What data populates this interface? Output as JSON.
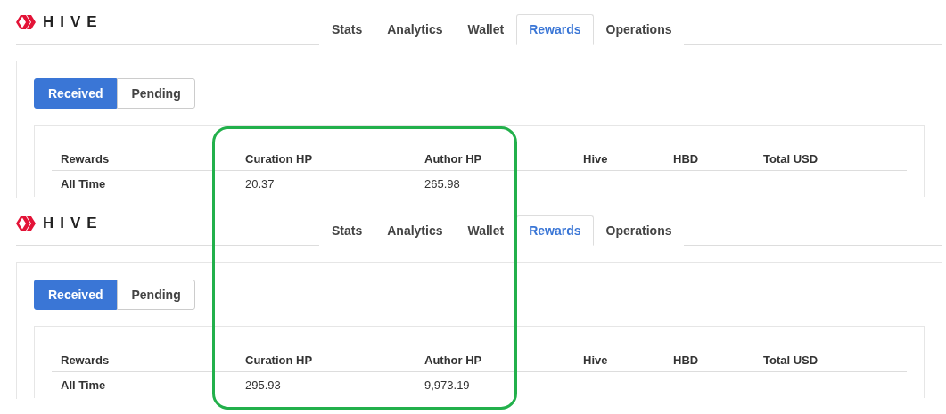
{
  "panels": [
    {
      "logo": "HIVE",
      "tabs": [
        {
          "label": "Stats",
          "selected": false
        },
        {
          "label": "Analytics",
          "selected": false
        },
        {
          "label": "Wallet",
          "selected": false
        },
        {
          "label": "Rewards",
          "selected": true
        },
        {
          "label": "Operations",
          "selected": false
        }
      ],
      "toggles": [
        {
          "label": "Received",
          "selected": true
        },
        {
          "label": "Pending",
          "selected": false
        }
      ],
      "table": {
        "columns": [
          "Rewards",
          "Curation HP",
          "Author HP",
          "Hive",
          "HBD",
          "Total USD"
        ],
        "rows": [
          {
            "cells": [
              "All Time",
              "20.37",
              "265.98"
            ]
          }
        ]
      }
    },
    {
      "logo": "HIVE",
      "tabs": [
        {
          "label": "Stats",
          "selected": false
        },
        {
          "label": "Analytics",
          "selected": false
        },
        {
          "label": "Wallet",
          "selected": false
        },
        {
          "label": "Rewards",
          "selected": true
        },
        {
          "label": "Operations",
          "selected": false
        }
      ],
      "toggles": [
        {
          "label": "Received",
          "selected": true
        },
        {
          "label": "Pending",
          "selected": false
        }
      ],
      "table": {
        "columns": [
          "Rewards",
          "Curation HP",
          "Author HP",
          "Hive",
          "HBD",
          "Total USD"
        ],
        "rows": [
          {
            "cells": [
              "All Time",
              "295.93",
              "9,973.19"
            ]
          }
        ]
      }
    }
  ]
}
